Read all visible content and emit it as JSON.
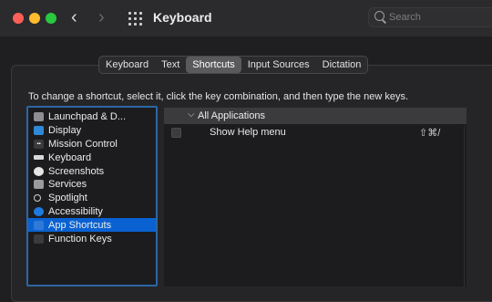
{
  "window": {
    "title": "Keyboard"
  },
  "search": {
    "placeholder": "Search"
  },
  "tabs": [
    {
      "label": "Keyboard"
    },
    {
      "label": "Text"
    },
    {
      "label": "Shortcuts",
      "active": true
    },
    {
      "label": "Input Sources"
    },
    {
      "label": "Dictation"
    }
  ],
  "instructions": "To change a shortcut, select it, click the key combination, and then type the new keys.",
  "categories": [
    {
      "label": "Launchpad & D...",
      "icon": "launchpad-icon"
    },
    {
      "label": "Display",
      "icon": "display-icon"
    },
    {
      "label": "Mission Control",
      "icon": "mission-control-icon"
    },
    {
      "label": "Keyboard",
      "icon": "keyboard-icon"
    },
    {
      "label": "Screenshots",
      "icon": "screenshots-icon"
    },
    {
      "label": "Services",
      "icon": "services-icon"
    },
    {
      "label": "Spotlight",
      "icon": "spotlight-icon"
    },
    {
      "label": "Accessibility",
      "icon": "accessibility-icon"
    },
    {
      "label": "App Shortcuts",
      "icon": "app-shortcuts-icon",
      "selected": true
    },
    {
      "label": "Function Keys",
      "icon": "function-keys-icon"
    }
  ],
  "shortcuts": {
    "group": "All Applications",
    "rows": [
      {
        "name": "Show Help menu",
        "keys": "⇧⌘/",
        "checked": false
      }
    ]
  },
  "colors": {
    "selection": "#0a62d2",
    "focus_ring": "#2c66a6",
    "close": "#ff5f57",
    "minimize": "#febc2e",
    "zoom": "#28c840"
  }
}
